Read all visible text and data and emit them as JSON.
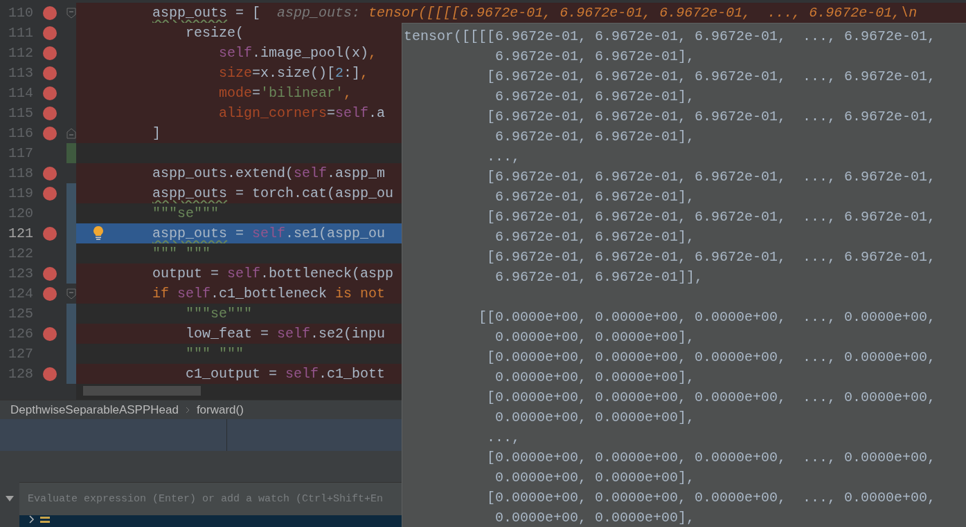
{
  "editor": {
    "lines": [
      {
        "number": "110",
        "breakpoint": true,
        "current": false,
        "bulb": false,
        "changed": false,
        "fold": {
          "kind": "start"
        },
        "tokens": [
          {
            "kind": "warn",
            "text": "        aspp_outs"
          },
          {
            "kind": "plain",
            "text": " = ["
          }
        ],
        "hint": {
          "label": "aspp_outs:",
          "value": "tensor([[[[6.9672e-01, 6.9672e-01, 6.9672e-01,  ..., 6.9672e-01,\\n"
        }
      },
      {
        "number": "111",
        "breakpoint": true,
        "current": false,
        "bulb": false,
        "changed": false,
        "tokens": [
          {
            "kind": "plain",
            "text": "            resize("
          }
        ]
      },
      {
        "number": "112",
        "breakpoint": true,
        "current": false,
        "bulb": false,
        "changed": false,
        "tokens": [
          {
            "kind": "self",
            "text": "                self"
          },
          {
            "kind": "plain",
            "text": ".image_pool(x)"
          },
          {
            "kind": "kw",
            "text": ","
          }
        ]
      },
      {
        "number": "113",
        "breakpoint": true,
        "current": false,
        "bulb": false,
        "changed": false,
        "tokens": [
          {
            "kind": "param",
            "text": "                size"
          },
          {
            "kind": "plain",
            "text": "=x.size()["
          },
          {
            "kind": "num",
            "text": "2"
          },
          {
            "kind": "plain",
            "text": ":]"
          },
          {
            "kind": "kw",
            "text": ","
          }
        ]
      },
      {
        "number": "114",
        "breakpoint": true,
        "current": false,
        "bulb": false,
        "changed": false,
        "tokens": [
          {
            "kind": "param",
            "text": "                mode"
          },
          {
            "kind": "plain",
            "text": "="
          },
          {
            "kind": "str",
            "text": "'bilinear'"
          },
          {
            "kind": "kw",
            "text": ","
          }
        ]
      },
      {
        "number": "115",
        "breakpoint": true,
        "current": false,
        "bulb": false,
        "changed": false,
        "tokens": [
          {
            "kind": "param",
            "text": "                align_corners"
          },
          {
            "kind": "plain",
            "text": "="
          },
          {
            "kind": "self",
            "text": "self"
          },
          {
            "kind": "plain",
            "text": ".a"
          }
        ]
      },
      {
        "number": "116",
        "breakpoint": true,
        "current": false,
        "bulb": false,
        "changed": false,
        "fold": {
          "kind": "end"
        },
        "tokens": [
          {
            "kind": "plain",
            "text": "        ]"
          }
        ]
      },
      {
        "number": "117",
        "breakpoint": false,
        "current": false,
        "bulb": false,
        "changed": true,
        "color": "#3f5a3f"
      },
      {
        "number": "118",
        "breakpoint": true,
        "current": false,
        "bulb": false,
        "changed": false,
        "tokens": [
          {
            "kind": "plain",
            "text": "        aspp_outs.extend("
          },
          {
            "kind": "self",
            "text": "self"
          },
          {
            "kind": "plain",
            "text": ".aspp_m"
          }
        ]
      },
      {
        "number": "119",
        "breakpoint": true,
        "current": false,
        "bulb": false,
        "changed": true,
        "color": "#3d5264",
        "tokens": [
          {
            "kind": "warn",
            "text": "        aspp_outs"
          },
          {
            "kind": "plain",
            "text": " = torch.cat(aspp_ou"
          }
        ]
      },
      {
        "number": "120",
        "breakpoint": false,
        "current": false,
        "bulb": false,
        "changed": true,
        "color": "#3d5264",
        "tokens": [
          {
            "kind": "str",
            "text": "        \"\"\"se\"\"\""
          }
        ]
      },
      {
        "number": "121",
        "breakpoint": true,
        "current": true,
        "bulb": true,
        "changed": true,
        "color": "#3d5264",
        "tokens": [
          {
            "kind": "warn",
            "text": "        aspp_outs"
          },
          {
            "kind": "plain",
            "text": " = "
          },
          {
            "kind": "self",
            "text": "self"
          },
          {
            "kind": "plain",
            "text": ".se1(aspp_ou"
          }
        ]
      },
      {
        "number": "122",
        "breakpoint": false,
        "current": false,
        "bulb": false,
        "changed": true,
        "color": "#3d5264",
        "tokens": [
          {
            "kind": "str",
            "text": "        \"\"\" \"\"\""
          }
        ]
      },
      {
        "number": "123",
        "breakpoint": true,
        "current": false,
        "bulb": false,
        "changed": true,
        "color": "#3d5264",
        "tokens": [
          {
            "kind": "plain",
            "text": "        output = "
          },
          {
            "kind": "self",
            "text": "self"
          },
          {
            "kind": "plain",
            "text": ".bottleneck(aspp"
          }
        ]
      },
      {
        "number": "124",
        "breakpoint": true,
        "current": false,
        "bulb": false,
        "changed": false,
        "fold": {
          "kind": "start"
        },
        "tokens": [
          {
            "kind": "kw",
            "text": "        if "
          },
          {
            "kind": "self",
            "text": "self"
          },
          {
            "kind": "plain",
            "text": ".c1_bottleneck "
          },
          {
            "kind": "kw",
            "text": "is not"
          }
        ]
      },
      {
        "number": "125",
        "breakpoint": false,
        "current": false,
        "bulb": false,
        "changed": true,
        "color": "#3d5264",
        "tokens": [
          {
            "kind": "str",
            "text": "            \"\"\"se\"\"\""
          }
        ]
      },
      {
        "number": "126",
        "breakpoint": true,
        "current": false,
        "bulb": false,
        "changed": true,
        "color": "#3d5264",
        "tokens": [
          {
            "kind": "plain",
            "text": "            low_feat = "
          },
          {
            "kind": "self",
            "text": "self"
          },
          {
            "kind": "plain",
            "text": ".se2(inpu"
          }
        ]
      },
      {
        "number": "127",
        "breakpoint": false,
        "current": false,
        "bulb": false,
        "changed": true,
        "color": "#3d5264",
        "tokens": [
          {
            "kind": "str",
            "text": "            \"\"\" \"\"\""
          }
        ]
      },
      {
        "number": "128",
        "breakpoint": true,
        "current": false,
        "bulb": false,
        "changed": true,
        "color": "#3d5264",
        "tokens": [
          {
            "kind": "plain",
            "text": "            c1_output = "
          },
          {
            "kind": "self",
            "text": "self"
          },
          {
            "kind": "plain",
            "text": ".c1_bott"
          }
        ]
      }
    ]
  },
  "breadcrumb": [
    "DepthwiseSeparableASPPHead",
    "forward()"
  ],
  "evaluate": {
    "placeholder": "Evaluate expression (Enter) or add a watch (Ctrl+Shift+En"
  },
  "popup": {
    "blocks": [
      [
        "tensor([[[[6.9672e-01, 6.9672e-01, 6.9672e-01,  ..., 6.9672e-01,",
        "           6.9672e-01, 6.9672e-01],",
        "          [6.9672e-01, 6.9672e-01, 6.9672e-01,  ..., 6.9672e-01,",
        "           6.9672e-01, 6.9672e-01],",
        "          [6.9672e-01, 6.9672e-01, 6.9672e-01,  ..., 6.9672e-01,",
        "           6.9672e-01, 6.9672e-01],",
        "          ...,",
        "          [6.9672e-01, 6.9672e-01, 6.9672e-01,  ..., 6.9672e-01,",
        "           6.9672e-01, 6.9672e-01],",
        "          [6.9672e-01, 6.9672e-01, 6.9672e-01,  ..., 6.9672e-01,",
        "           6.9672e-01, 6.9672e-01],",
        "          [6.9672e-01, 6.9672e-01, 6.9672e-01,  ..., 6.9672e-01,",
        "           6.9672e-01, 6.9672e-01]],"
      ],
      [
        "         [[0.0000e+00, 0.0000e+00, 0.0000e+00,  ..., 0.0000e+00,",
        "           0.0000e+00, 0.0000e+00],",
        "          [0.0000e+00, 0.0000e+00, 0.0000e+00,  ..., 0.0000e+00,",
        "           0.0000e+00, 0.0000e+00],",
        "          [0.0000e+00, 0.0000e+00, 0.0000e+00,  ..., 0.0000e+00,",
        "           0.0000e+00, 0.0000e+00],",
        "          ...,",
        "          [0.0000e+00, 0.0000e+00, 0.0000e+00,  ..., 0.0000e+00,",
        "           0.0000e+00, 0.0000e+00],",
        "          [0.0000e+00, 0.0000e+00, 0.0000e+00,  ..., 0.0000e+00,",
        "           0.0000e+00, 0.0000e+00],"
      ]
    ]
  }
}
